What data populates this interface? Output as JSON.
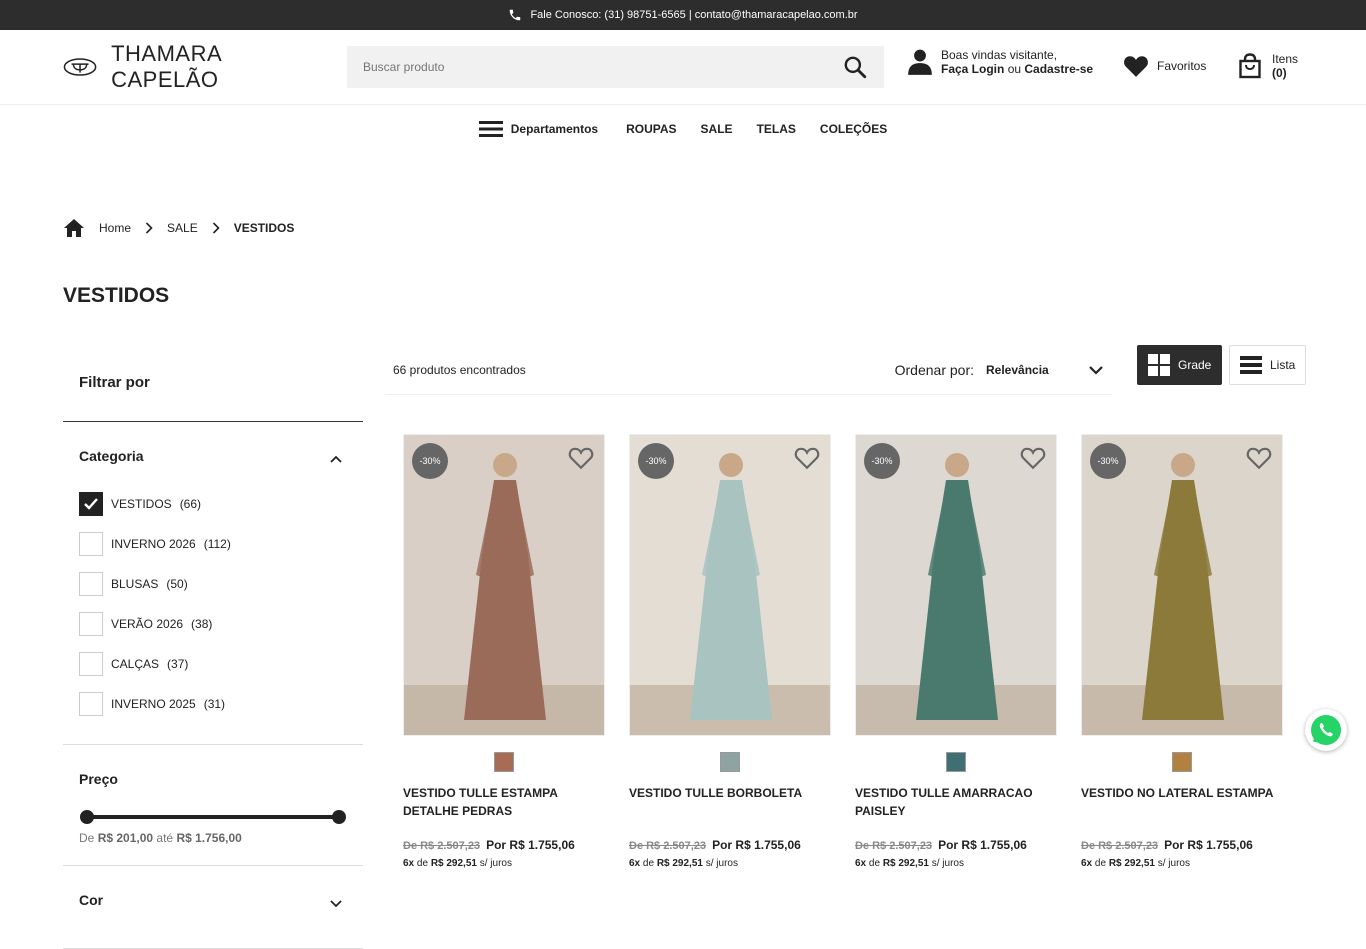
{
  "topbar": {
    "contact": "Fale Conosco: (31) 98751-6565 | contato@thamaracapelao.com.br"
  },
  "header": {
    "brand": "THAMARA CAPELÃO",
    "search_placeholder": "Buscar produto",
    "welcome": "Boas vindas visitante,",
    "login": "Faça Login",
    "or": "ou",
    "signup": "Cadastre-se",
    "favorites": "Favoritos",
    "cart_label": "Itens",
    "cart_count": "(0)"
  },
  "nav": {
    "departments": "Departamentos",
    "items": [
      "ROUPAS",
      "SALE",
      "TELAS",
      "COLEÇÕES"
    ]
  },
  "breadcrumb": [
    "Home",
    "SALE",
    "VESTIDOS"
  ],
  "page_title": "VESTIDOS",
  "filters": {
    "heading": "Filtrar por",
    "category_title": "Categoria",
    "categories": [
      {
        "label": "VESTIDOS",
        "count": "(66)",
        "checked": true
      },
      {
        "label": "INVERNO 2026",
        "count": "(112)",
        "checked": false
      },
      {
        "label": "BLUSAS",
        "count": "(50)",
        "checked": false
      },
      {
        "label": "VERÃO 2026",
        "count": "(38)",
        "checked": false
      },
      {
        "label": "CALÇAS",
        "count": "(37)",
        "checked": false
      },
      {
        "label": "INVERNO 2025",
        "count": "(31)",
        "checked": false
      }
    ],
    "price_title": "Preço",
    "price_from_label": "De",
    "price_min": "R$ 201,00",
    "price_to_label": "até",
    "price_max": "R$ 1.756,00",
    "color_title": "Cor"
  },
  "toolbar": {
    "count": "66 produtos encontrados",
    "sort_label": "Ordenar por:",
    "sort_value": "Relevância",
    "grid_label": "Grade",
    "list_label": "Lista"
  },
  "products": [
    {
      "name": "VESTIDO TULLE ESTAMPA DETALHE PEDRAS",
      "badge": "-30%",
      "old_price": "De R$ 2.507,23",
      "new_price": "Por R$ 1.755,06",
      "inst_n": "6x",
      "inst_de": "de",
      "inst_val": "R$ 292,51",
      "inst_sj": "s/ juros",
      "color": "#a86b55",
      "bg": "#d9cfc6",
      "dress": "#9b6b5a"
    },
    {
      "name": "VESTIDO TULLE BORBOLETA",
      "badge": "-30%",
      "old_price": "De R$ 2.507,23",
      "new_price": "Por R$ 1.755,06",
      "inst_n": "6x",
      "inst_de": "de",
      "inst_val": "R$ 292,51",
      "inst_sj": "s/ juros",
      "color": "#8fa3a3",
      "bg": "#e3ddd4",
      "dress": "#a9c3c0"
    },
    {
      "name": "VESTIDO TULLE AMARRACAO PAISLEY",
      "badge": "-30%",
      "old_price": "De R$ 2.507,23",
      "new_price": "Por R$ 1.755,06",
      "inst_n": "6x",
      "inst_de": "de",
      "inst_val": "R$ 292,51",
      "inst_sj": "s/ juros",
      "color": "#3f6e73",
      "bg": "#ddd8d1",
      "dress": "#4a7a6e"
    },
    {
      "name": "VESTIDO NO LATERAL ESTAMPA",
      "badge": "-30%",
      "old_price": "De R$ 2.507,23",
      "new_price": "Por R$ 1.755,06",
      "inst_n": "6x",
      "inst_de": "de",
      "inst_val": "R$ 292,51",
      "inst_sj": "s/ juros",
      "color": "#b3813f",
      "bg": "#dcd5cc",
      "dress": "#8b7a3a"
    }
  ]
}
